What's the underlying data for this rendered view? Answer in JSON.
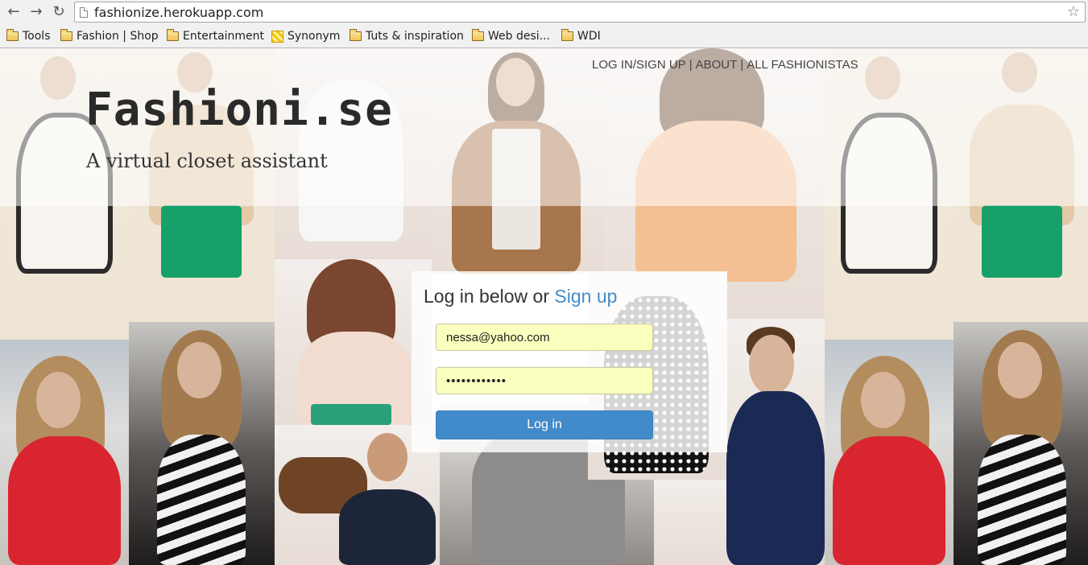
{
  "browser": {
    "url": "fashionize.herokuapp.com",
    "nav_icons": [
      "back-arrow-icon",
      "forward-arrow-icon",
      "reload-icon"
    ],
    "bookmarks": [
      {
        "label": "Tools",
        "icon": "folder-icon"
      },
      {
        "label": "Fashion | Shop",
        "icon": "folder-icon"
      },
      {
        "label": "Entertainment",
        "icon": "folder-icon"
      },
      {
        "label": "Synonym",
        "icon": "synonym-icon"
      },
      {
        "label": "Tuts & inspiration",
        "icon": "folder-icon"
      },
      {
        "label": "Web desi...",
        "icon": "folder-icon"
      },
      {
        "label": "WDI",
        "icon": "folder-icon"
      }
    ]
  },
  "site": {
    "brand": "Fashioni.se",
    "tagline": "A virtual closet assistant",
    "nav": {
      "login_signup": "LOG IN/SIGN UP",
      "separator": "|",
      "about": "ABOUT",
      "all_fashionistas": "ALL FASHIONISTAS"
    }
  },
  "login": {
    "title_prefix": "Log in below or ",
    "signup_link": "Sign up",
    "email_value": "nessa@yahoo.com",
    "password_value": "••••••••••••",
    "button_label": "Log in"
  },
  "colors": {
    "link": "#428bca",
    "button": "#428bca",
    "autofill": "#faffbd"
  }
}
